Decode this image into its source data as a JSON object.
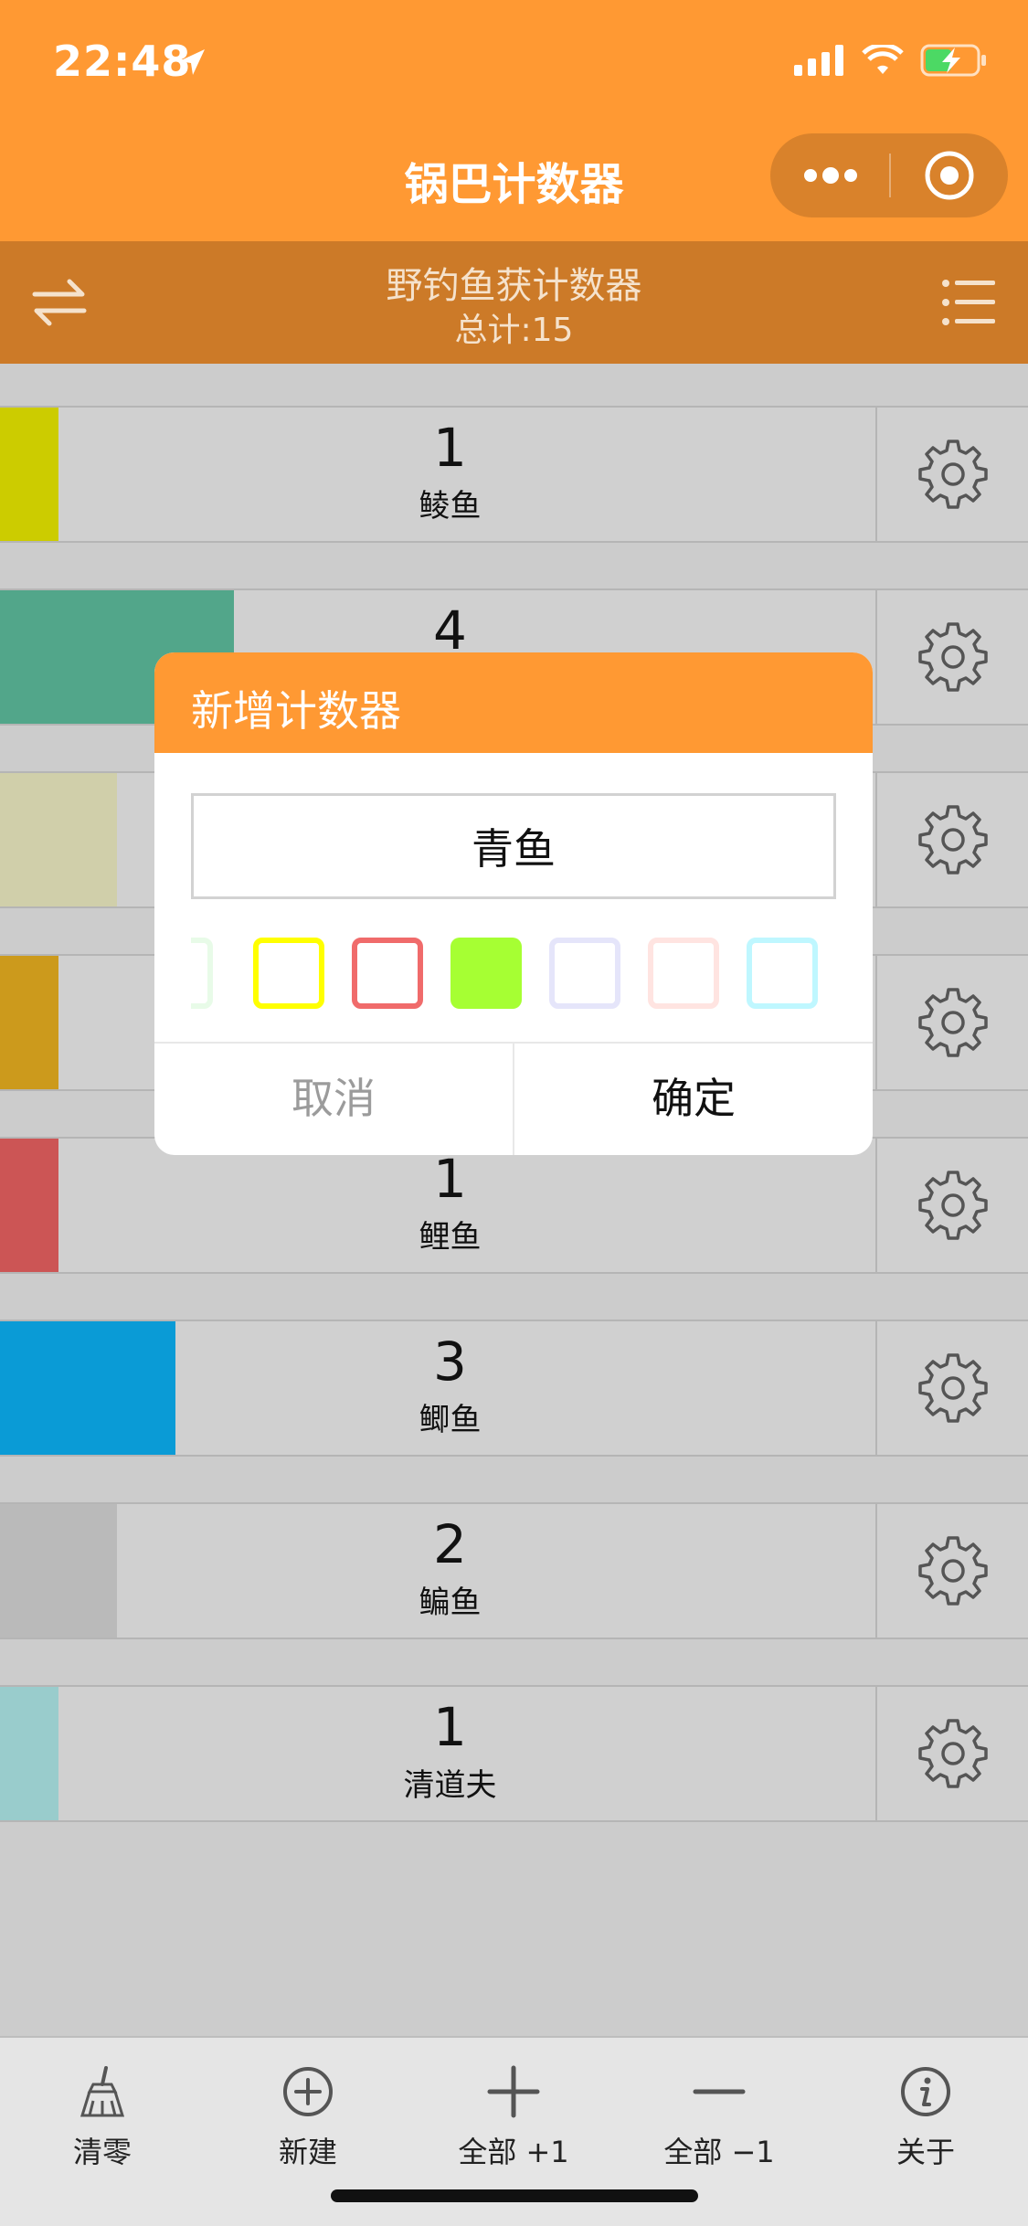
{
  "status": {
    "time": "22:48"
  },
  "nav": {
    "title": "锅巴计数器"
  },
  "header": {
    "name": "野钓鱼获计数器",
    "total": "总计:15"
  },
  "counters": [
    {
      "count": "1",
      "label": "鲮鱼",
      "color": "#cccc00",
      "level": 1
    },
    {
      "count": "4",
      "label": "",
      "color": "#52a68a",
      "level": 4
    },
    {
      "count": "",
      "label": "",
      "color": "#d0cfaa",
      "level": 2
    },
    {
      "count": "",
      "label": "",
      "color": "#cc9a1c",
      "level": 1
    },
    {
      "count": "1",
      "label": "鲤鱼",
      "color": "#cc5555",
      "level": 1
    },
    {
      "count": "3",
      "label": "鲫鱼",
      "color": "#0a9bd6",
      "level": 3
    },
    {
      "count": "2",
      "label": "鳊鱼",
      "color": "#bababa",
      "level": 2
    },
    {
      "count": "1",
      "label": "清道夫",
      "color": "#99cccc",
      "level": 1
    }
  ],
  "dialog": {
    "title": "新增计数器",
    "input_value": "青鱼",
    "swatches": [
      {
        "color": "#e8fbe8",
        "selected": false
      },
      {
        "color": "#ffff00",
        "selected": false
      },
      {
        "color": "#f06b6b",
        "selected": false
      },
      {
        "color": "#a6ff33",
        "selected": true
      },
      {
        "color": "#e5e5fa",
        "selected": false
      },
      {
        "color": "#ffe4e1",
        "selected": false
      },
      {
        "color": "#bff7ff",
        "selected": false
      }
    ],
    "cancel": "取消",
    "confirm": "确定"
  },
  "tabs": [
    {
      "label": "清零",
      "icon": "broom-icon"
    },
    {
      "label": "新建",
      "icon": "plus-circle-icon"
    },
    {
      "label": "全部 +1",
      "icon": "plus-icon"
    },
    {
      "label": "全部 −1",
      "icon": "minus-icon"
    },
    {
      "label": "关于",
      "icon": "info-icon"
    }
  ]
}
